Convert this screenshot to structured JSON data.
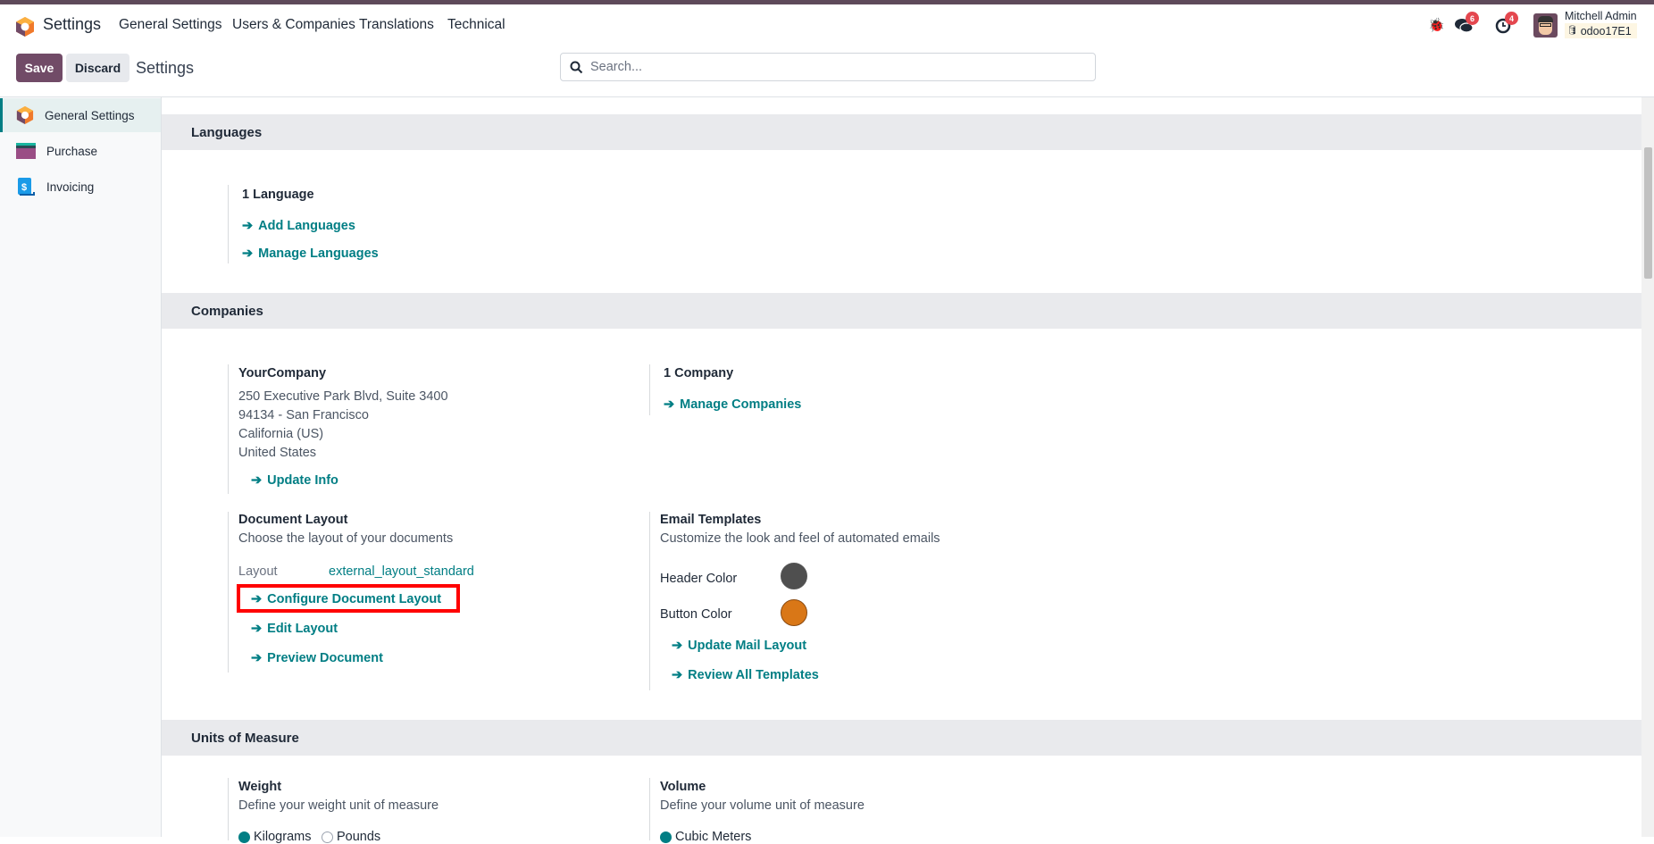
{
  "navbar": {
    "app_name": "Settings",
    "menu": [
      "General Settings",
      "Users & Companies",
      "Translations",
      "Technical"
    ],
    "messages_count": "6",
    "activities_count": "4",
    "user_name": "Mitchell Admin",
    "database": "odoo17E1"
  },
  "control_panel": {
    "save_label": "Save",
    "discard_label": "Discard",
    "breadcrumb": "Settings",
    "search_placeholder": "Search..."
  },
  "sidebar": {
    "items": [
      {
        "label": "General Settings",
        "active": true
      },
      {
        "label": "Purchase"
      },
      {
        "label": "Invoicing"
      }
    ]
  },
  "languages": {
    "header": "Languages",
    "count": "1 Language",
    "add": "Add Languages",
    "manage": "Manage Languages"
  },
  "companies": {
    "header": "Companies",
    "company_name": "YourCompany",
    "address": [
      "250 Executive Park Blvd, Suite 3400",
      "94134 - San Francisco",
      "California (US)",
      "United States"
    ],
    "update_info": "Update Info",
    "count": "1 Company",
    "manage": "Manage Companies",
    "document_layout": {
      "title": "Document Layout",
      "desc": "Choose the layout of your documents",
      "layout_label": "Layout",
      "layout_value": "external_layout_standard",
      "configure": "Configure Document Layout",
      "edit": "Edit Layout",
      "preview": "Preview Document"
    },
    "email_templates": {
      "title": "Email Templates",
      "desc": "Customize the look and feel of automated emails",
      "header_color_label": "Header Color",
      "header_color": "#4f4f4f",
      "button_color_label": "Button Color",
      "button_color": "#d97717",
      "update_mail": "Update Mail Layout",
      "review": "Review All Templates"
    }
  },
  "uom": {
    "header": "Units of Measure",
    "weight_title": "Weight",
    "weight_desc": "Define your weight unit of measure",
    "weight_options": [
      "Kilograms",
      "Pounds"
    ],
    "weight_selected": "Kilograms",
    "volume_title": "Volume",
    "volume_desc": "Define your volume unit of measure",
    "volume_options": [
      "Cubic Meters"
    ],
    "volume_selected": "Cubic Meters"
  },
  "colors": {
    "brand": "#714b67",
    "accent": "#017e84",
    "highlight_box": "#ff0000"
  }
}
